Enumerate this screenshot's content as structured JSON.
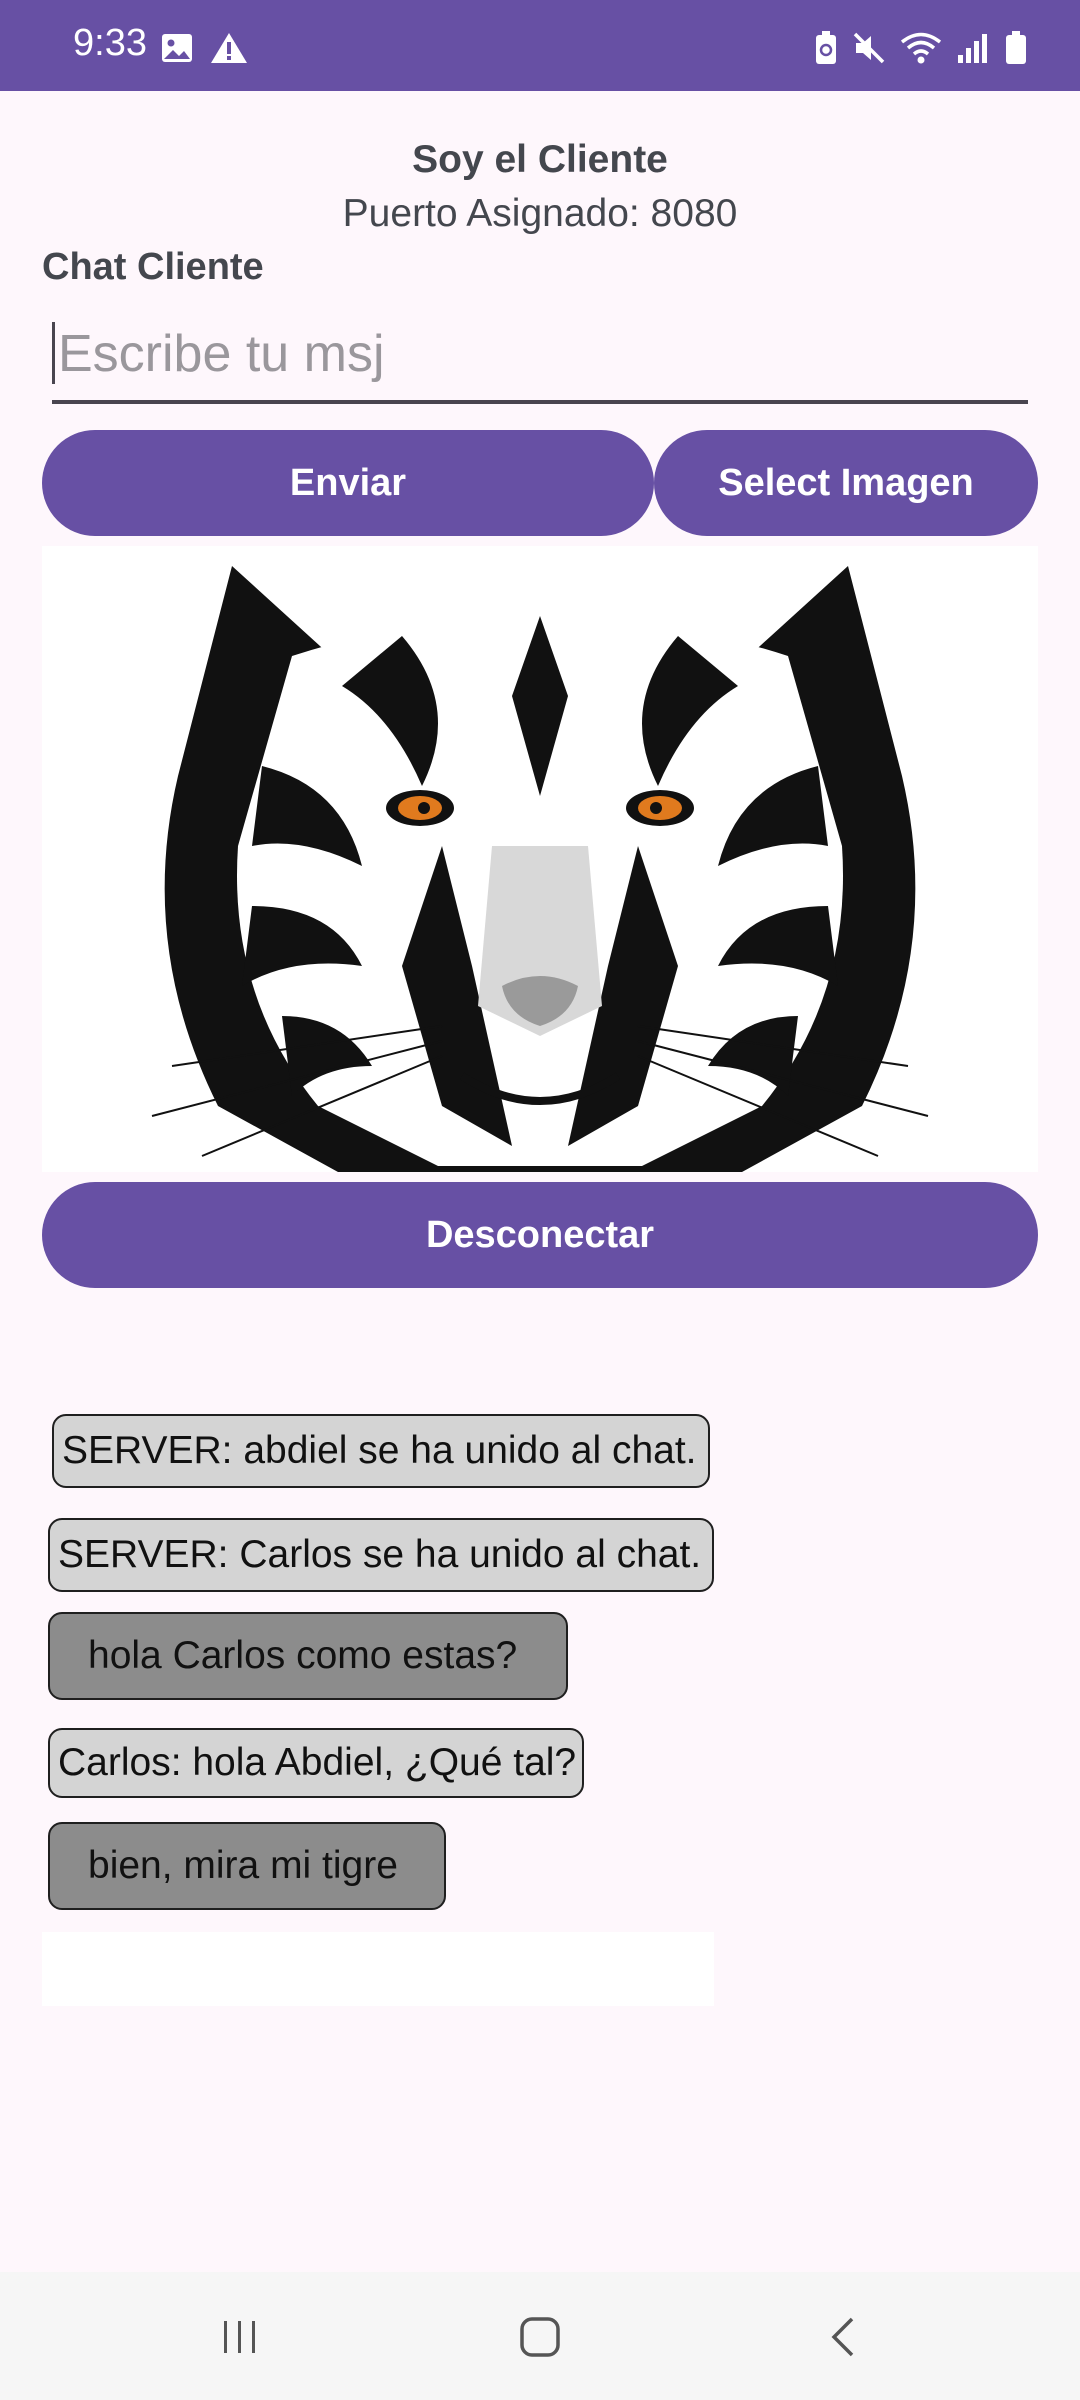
{
  "status_bar": {
    "time": "9:33",
    "left_icons": [
      "gallery-icon",
      "warning-icon"
    ],
    "right_icons": [
      "battery-saver-icon",
      "mute-icon",
      "wifi-icon",
      "signal-icon",
      "battery-icon"
    ],
    "bg_color": "#6750A4"
  },
  "header": {
    "title": "Soy el Cliente",
    "port": "Puerto Asignado: 8080",
    "chat_label": "Chat Cliente"
  },
  "input": {
    "placeholder": "Escribe tu msj",
    "value": ""
  },
  "buttons": {
    "send": "Enviar",
    "select_image": "Select Imagen",
    "disconnect": "Desconectar"
  },
  "image": {
    "description_icon": "tiger-face-image"
  },
  "messages": [
    {
      "text": "SERVER: abdiel se ha unido al chat.",
      "type": "server"
    },
    {
      "text": "SERVER: Carlos se ha unido al chat.",
      "type": "server"
    },
    {
      "text": "hola Carlos como estas?",
      "type": "me"
    },
    {
      "text": "Carlos: hola Abdiel, ¿Qué tal?",
      "type": "server"
    },
    {
      "text": "bien, mira mi tigre",
      "type": "me"
    }
  ],
  "nav_bar": {
    "icons": [
      "recent-apps-icon",
      "home-icon",
      "back-icon"
    ]
  },
  "colors": {
    "accent": "#6750A4",
    "background": "#FEF7FC",
    "bubble_server": "#D4D4D4",
    "bubble_me": "#8C8C8C"
  }
}
